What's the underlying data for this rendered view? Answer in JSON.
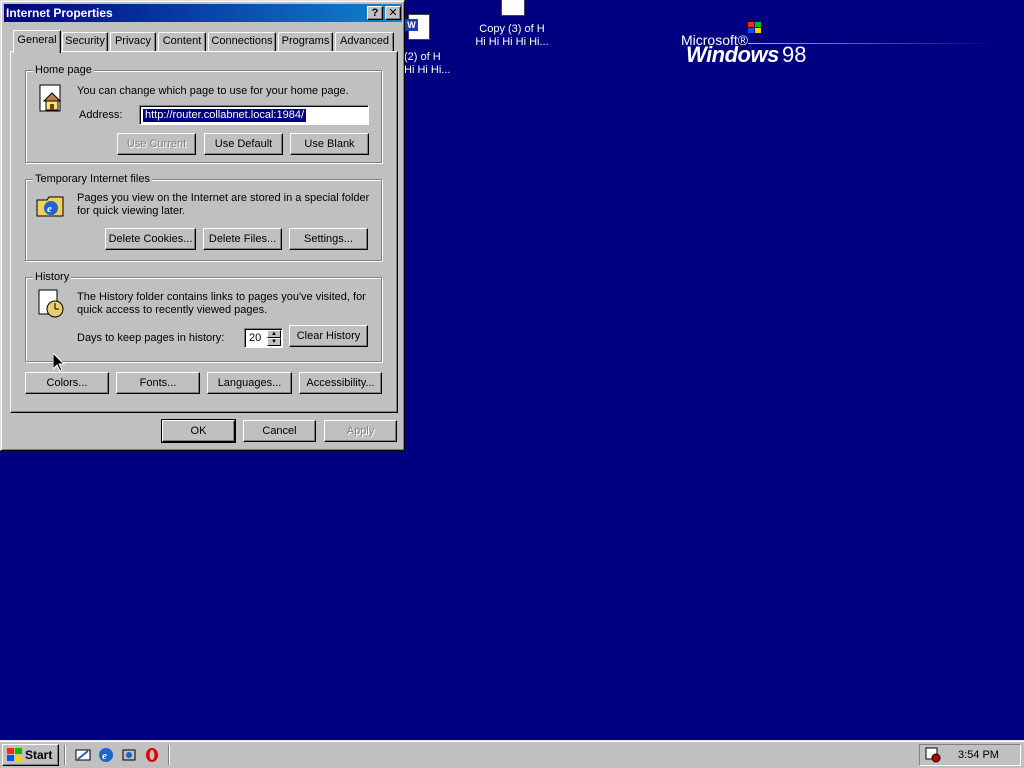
{
  "desktop": {
    "icon1_line1": "(2) of H",
    "icon1_line2": "Hi Hi Hi...",
    "icon2_line1": "Copy (3) of H",
    "icon2_line2": "Hi Hi Hi Hi Hi...",
    "logo_microsoft": "Microsoft®",
    "logo_windows": "Windows",
    "logo_98": "98"
  },
  "dialog": {
    "title": "Internet Properties",
    "help_btn": "?",
    "close_btn": "✕",
    "tabs": [
      "General",
      "Security",
      "Privacy",
      "Content",
      "Connections",
      "Programs",
      "Advanced"
    ],
    "active_tab": "General",
    "homepage": {
      "label": "Home page",
      "desc": "You can change which page to use for your home page.",
      "address_label": "Address:",
      "address_value": "http://router.collabnet.local:1984/",
      "use_current": "Use Current",
      "use_default": "Use Default",
      "use_blank": "Use Blank"
    },
    "temp_files": {
      "label": "Temporary Internet files",
      "desc1": "Pages you view on the Internet are stored in a special folder",
      "desc2": "for quick viewing later.",
      "delete_cookies": "Delete Cookies...",
      "delete_files": "Delete Files...",
      "settings": "Settings..."
    },
    "history": {
      "label": "History",
      "desc1": "The History folder contains links to pages you've visited, for",
      "desc2": "quick access to recently viewed pages.",
      "days_label": "Days to keep pages in history:",
      "days_value": "20",
      "clear_history": "Clear History"
    },
    "bottom_buttons": {
      "colors": "Colors...",
      "fonts": "Fonts...",
      "languages": "Languages...",
      "accessibility": "Accessibility..."
    },
    "ok": "OK",
    "cancel": "Cancel",
    "apply": "Apply"
  },
  "taskbar": {
    "start": "Start",
    "clock": "3:54 PM"
  }
}
